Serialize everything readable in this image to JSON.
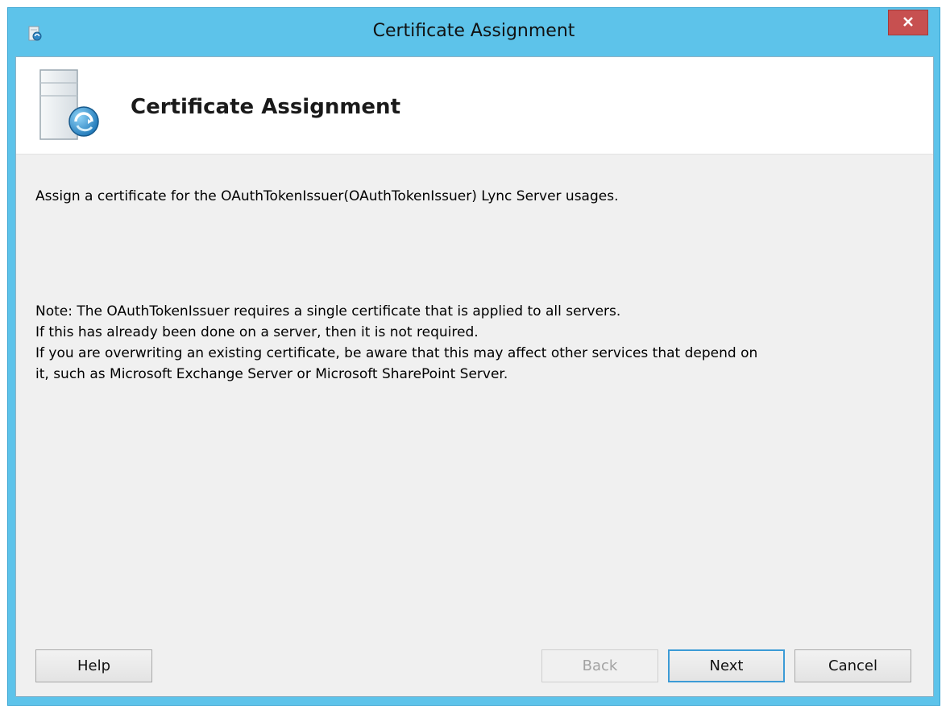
{
  "window": {
    "title": "Certificate Assignment",
    "close_label": "x"
  },
  "header": {
    "title": "Certificate Assignment"
  },
  "content": {
    "description": "Assign a certificate for the OAuthTokenIssuer(OAuthTokenIssuer) Lync Server usages.",
    "note_lines": [
      "Note: The OAuthTokenIssuer requires a single certificate that is applied to all servers.",
      "If this has already been done on a server, then it is not required.",
      "If you are overwriting an existing certificate, be aware that this may affect other services that depend on",
      "it, such as Microsoft Exchange Server or Microsoft SharePoint Server."
    ]
  },
  "buttons": {
    "help": "Help",
    "back": "Back",
    "next": "Next",
    "cancel": "Cancel"
  },
  "colors": {
    "titlebar": "#5dc3ea",
    "close_button": "#c75050",
    "client_background": "#f0f0f0",
    "header_background": "#ffffff",
    "default_button_border": "#3c9bd6"
  },
  "icons": {
    "app": "certificate-wizard-icon",
    "header": "server-certificate-icon",
    "close": "close-icon"
  }
}
